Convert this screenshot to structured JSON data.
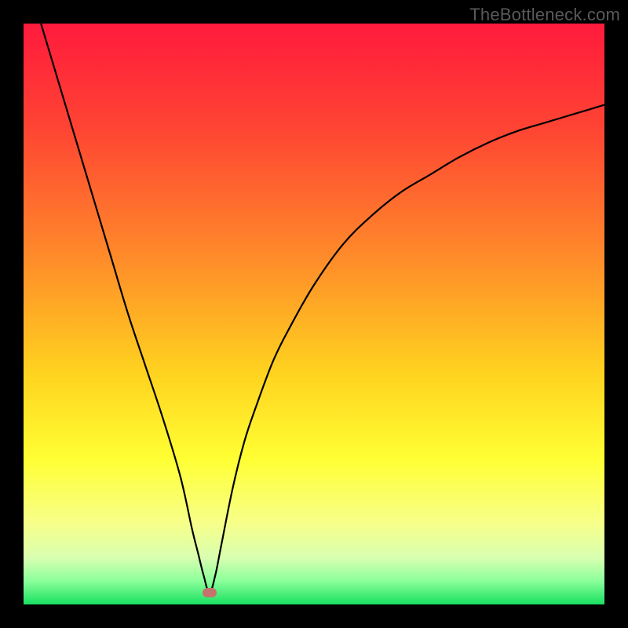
{
  "watermark": "TheBottleneck.com",
  "colors": {
    "background": "#000000",
    "marker": "#c6736e",
    "curve": "#000000",
    "watermark": "#5a5a5a",
    "gradient_stops": [
      {
        "pct": 0,
        "color": "#ff1a3c"
      },
      {
        "pct": 18,
        "color": "#ff4433"
      },
      {
        "pct": 40,
        "color": "#ff8a2a"
      },
      {
        "pct": 60,
        "color": "#ffd21f"
      },
      {
        "pct": 75,
        "color": "#ffff33"
      },
      {
        "pct": 86,
        "color": "#f7ff8a"
      },
      {
        "pct": 92,
        "color": "#d8ffb0"
      },
      {
        "pct": 96,
        "color": "#8aff9a"
      },
      {
        "pct": 100,
        "color": "#18e060"
      }
    ]
  },
  "chart_data": {
    "type": "line",
    "title": "",
    "xlabel": "",
    "ylabel": "",
    "xlim": [
      0,
      100
    ],
    "ylim": [
      0,
      100
    ],
    "grid": false,
    "legend": false,
    "marker": {
      "x": 32,
      "y": 2
    },
    "series": [
      {
        "name": "curve",
        "x": [
          3,
          6,
          9,
          12,
          15,
          18,
          21,
          24,
          27,
          29,
          30,
          31,
          32,
          33,
          34,
          36,
          38,
          40,
          43,
          46,
          50,
          55,
          60,
          65,
          70,
          75,
          80,
          85,
          90,
          95,
          100
        ],
        "y": [
          100,
          90,
          80,
          70,
          60,
          50,
          41,
          32,
          22,
          13,
          9,
          5,
          2,
          5,
          10,
          20,
          28,
          34,
          42,
          48,
          55,
          62,
          67,
          71,
          74,
          77,
          79.5,
          81.5,
          83,
          84.5,
          86
        ]
      }
    ]
  }
}
